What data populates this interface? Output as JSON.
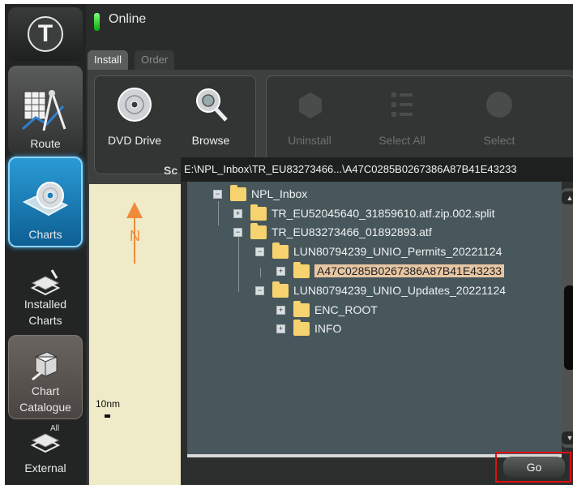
{
  "status": {
    "text": "Online",
    "led_color": "#22cc22"
  },
  "tabs": [
    {
      "label": "Install",
      "active": true
    },
    {
      "label": "Order",
      "active": false
    }
  ],
  "sidebar": {
    "items": [
      {
        "label": "Route",
        "icon": "route-planner-icon"
      },
      {
        "label": "Charts",
        "icon": "charts-disc-icon",
        "active": true
      },
      {
        "label": "Installed\nCharts",
        "icon": "installed-charts-icon"
      },
      {
        "label": "Chart\nCatalogue",
        "icon": "chart-catalogue-icon"
      },
      {
        "label": "External",
        "icon": "external-charts-icon",
        "badge": "All"
      }
    ]
  },
  "toolbar": {
    "dvd_label": "DVD Drive",
    "browse_label": "Browse",
    "uninstall_label": "Uninstall",
    "select_all_label": "Select All",
    "select_label": "Select",
    "section_label_partial": "Sc"
  },
  "chart": {
    "scale_label": "10nm",
    "north_letter": "N",
    "north_color": "#f08a3a"
  },
  "browser": {
    "path": "E:\\NPL_Inbox\\TR_EU83273466...\\A47C0285B0267386A87B41E43233",
    "nodes": [
      {
        "label": "NPL_Inbox",
        "expander": "−"
      },
      {
        "label": "TR_EU52045640_31859610.atf.zip.002.split",
        "expander": "+"
      },
      {
        "label": "TR_EU83273466_01892893.atf",
        "expander": "−"
      },
      {
        "label": "LUN80794239_UNIO_Permits_20221124",
        "expander": "−"
      },
      {
        "label": "A47C0285B0267386A87B41E43233",
        "expander": "+",
        "selected": true
      },
      {
        "label": "LUN80794239_UNIO_Updates_20221124",
        "expander": "−"
      },
      {
        "label": "ENC_ROOT",
        "expander": "+"
      },
      {
        "label": "INFO",
        "expander": "+"
      }
    ]
  },
  "actions": {
    "go_label": "Go",
    "highlight_color": "#e01010"
  },
  "colors": {
    "accent": "#1a8fd0",
    "tree_bg": "#48575c",
    "selection": "#e7c6a3"
  }
}
